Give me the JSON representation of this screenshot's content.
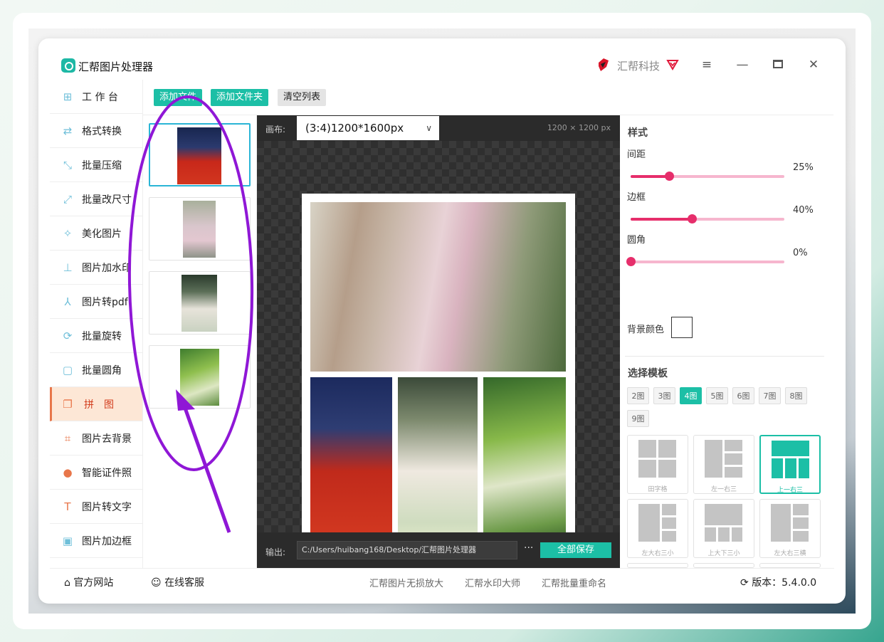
{
  "app": {
    "title": "汇帮图片处理器",
    "brand": "汇帮科技"
  },
  "toolbar": {
    "add_file": "添加文件",
    "add_folder": "添加文件夹",
    "clear_list": "清空列表"
  },
  "sidebar": {
    "items": [
      {
        "label": "工 作 台",
        "icon": "grid-icon"
      },
      {
        "label": "格式转换",
        "icon": "format-convert-icon"
      },
      {
        "label": "批量压缩",
        "icon": "compress-icon"
      },
      {
        "label": "批量改尺寸",
        "icon": "resize-icon"
      },
      {
        "label": "美化图片",
        "icon": "beautify-icon"
      },
      {
        "label": "图片加水印",
        "icon": "watermark-icon"
      },
      {
        "label": "图片转pdf",
        "icon": "pdf-icon"
      },
      {
        "label": "批量旋转",
        "icon": "rotate-icon"
      },
      {
        "label": "批量圆角",
        "icon": "round-corner-icon"
      },
      {
        "label": "拼　图",
        "icon": "collage-icon",
        "active": true
      },
      {
        "label": "图片去背景",
        "icon": "crop-icon"
      },
      {
        "label": "智能证件照",
        "icon": "id-photo-icon"
      },
      {
        "label": "图片转文字",
        "icon": "text-icon"
      },
      {
        "label": "图片加边框",
        "icon": "frame-icon"
      }
    ]
  },
  "canvas": {
    "label": "画布:",
    "size_option": "(3:4)1200*1600px",
    "dimension": "1200 × 1200 px"
  },
  "output": {
    "label": "输出:",
    "path": "C:/Users/huibang168/Desktop/汇帮图片处理器",
    "more": "···",
    "save_all": "全部保存"
  },
  "style_panel": {
    "title": "样式",
    "sliders": [
      {
        "label": "间距",
        "value": 25,
        "display": "25%"
      },
      {
        "label": "边框",
        "value": 40,
        "display": "40%"
      },
      {
        "label": "圆角",
        "value": 0,
        "display": "0%"
      }
    ],
    "bg_color_label": "背景颜色",
    "bg_color": "#ffffff"
  },
  "templates": {
    "title": "选择模板",
    "counts": [
      "2图",
      "3图",
      "4图",
      "5图",
      "6图",
      "7图",
      "8图",
      "9图"
    ],
    "active_count": "4图",
    "items": [
      {
        "name": "田字格"
      },
      {
        "name": "左一右三"
      },
      {
        "name": "上一右三",
        "active": true
      },
      {
        "name": "左大右三小"
      },
      {
        "name": "上大下三小"
      },
      {
        "name": "左大右三横"
      },
      {
        "name": ""
      },
      {
        "name": ""
      },
      {
        "name": ""
      }
    ]
  },
  "footer": {
    "website": "官方网站",
    "support": "在线客服",
    "links": [
      "汇帮图片无损放大",
      "汇帮水印大师",
      "汇帮批量重命名"
    ],
    "version": "版本：5.4.0.0"
  },
  "colors": {
    "accent": "#1cbfa6",
    "active_side": "#fde7d6",
    "slider": "#e62e6b",
    "annotation": "#8f17d6"
  }
}
